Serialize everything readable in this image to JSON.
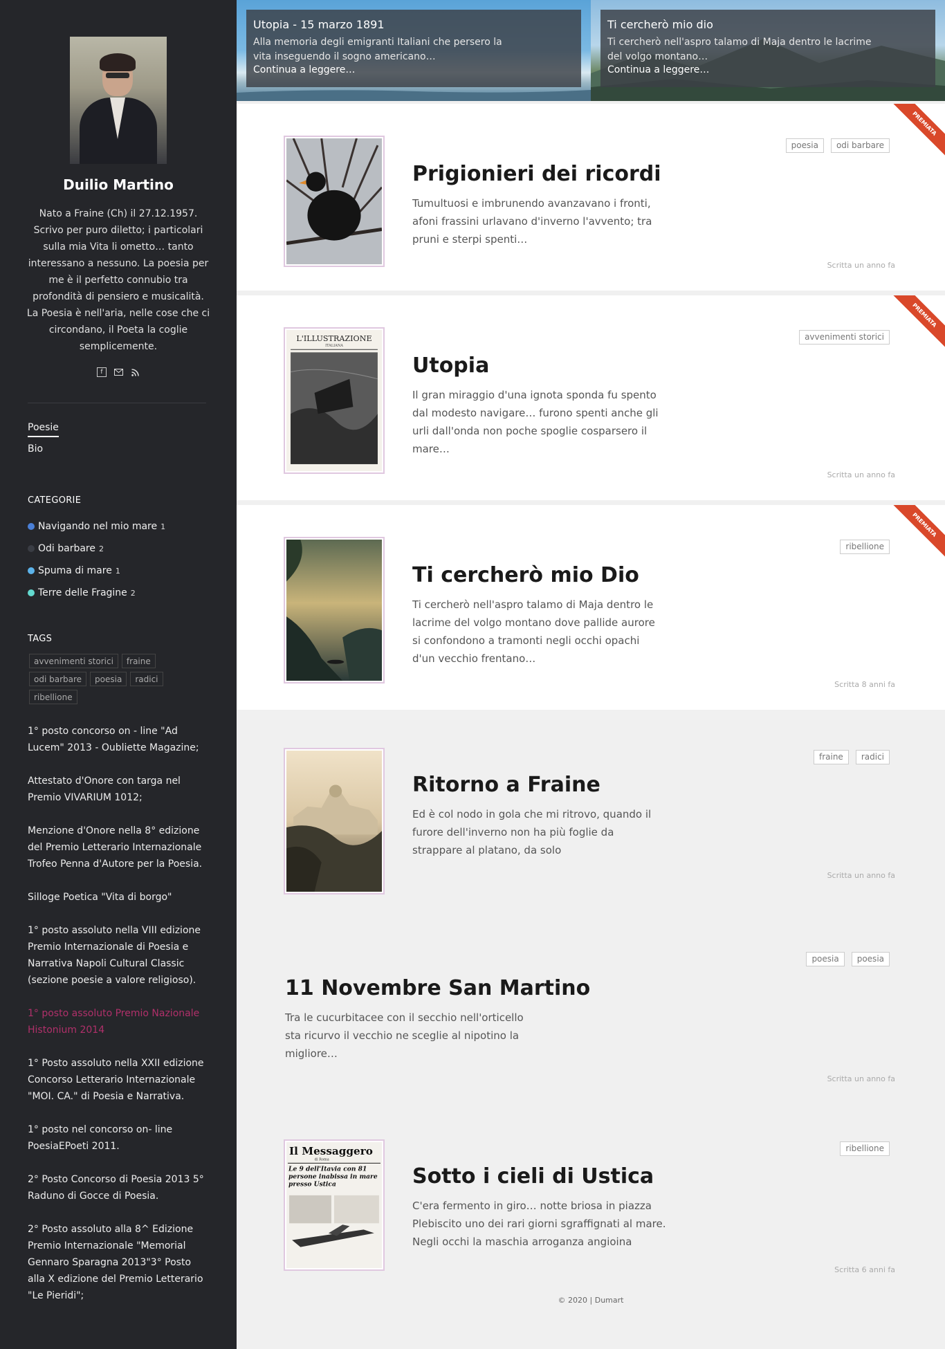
{
  "author": {
    "name": "Duilio Martino",
    "bio": "Nato a Fraine (Ch) il 27.12.1957. Scrivo per puro diletto; i particolari sulla mia Vita li ometto… tanto interessano a nessuno. La poesia per me è il perfetto connubio tra profondità di pensiero e musicalità. La Poesia è nell'aria, nelle cose che ci circondano, il Poeta la coglie semplicemente.",
    "social_icons": [
      "facebook-icon",
      "mail-icon",
      "rss-icon"
    ]
  },
  "nav": [
    {
      "label": "Poesie",
      "active": true
    },
    {
      "label": "Bio",
      "active": false
    }
  ],
  "categories": {
    "heading": "CATEGORIE",
    "items": [
      {
        "label": "Navigando nel mio mare",
        "count": "1",
        "color": "#4a7fd6"
      },
      {
        "label": "Odi barbare",
        "count": "2",
        "color": "#3a3d44"
      },
      {
        "label": "Spuma di mare",
        "count": "1",
        "color": "#5cb3ea"
      },
      {
        "label": "Terre delle Fragine",
        "count": "2",
        "color": "#63d9cf"
      }
    ]
  },
  "tags": {
    "heading": "TAGS",
    "items": [
      "avvenimenti storici",
      "fraine",
      "odi barbare",
      "poesia",
      "radici",
      "ribellione"
    ]
  },
  "awards": [
    {
      "text": "1° posto concorso on - line \"Ad Lucem\" 2013 - Oubliette Magazine;",
      "highlight": false
    },
    {
      "text": "Attestato d'Onore con targa nel Premio VIVARIUM 1012;",
      "highlight": false
    },
    {
      "text": "Menzione d'Onore nella 8° edizione del Premio Letterario Internazionale Trofeo Penna d'Autore per la Poesia.",
      "highlight": false
    },
    {
      "text": "Silloge Poetica \"Vita di borgo\"",
      "highlight": false
    },
    {
      "text": "1° posto assoluto nella VIII edizione Premio Internazionale di Poesia e Narrativa Napoli Cultural Classic (sezione poesie a valore religioso).",
      "highlight": false
    },
    {
      "text": "1° posto assoluto Premio Nazionale Histonium 2014",
      "highlight": true
    },
    {
      "text": "1° Posto assoluto nella XXII edizione Concorso Letterario Internazionale \"MOI. CA.\" di Poesia e Narrativa.",
      "highlight": false
    },
    {
      "text": "1° posto nel concorso on- line PoesiaEPoeti 2011.",
      "highlight": false
    },
    {
      "text": "2° Posto Concorso di Poesia 2013 5° Raduno di Gocce di Poesia.",
      "highlight": false
    },
    {
      "text": "2° Posto assoluto alla 8^ Edizione Premio Internazionale \"Memorial Gennaro Sparagna 2013\"3° Posto alla X edizione del Premio Letterario \"Le Pieridi\";",
      "highlight": false
    }
  ],
  "hero": [
    {
      "title": "Utopia - 15 marzo 1891",
      "excerpt": "Alla memoria degli emigranti Italiani che persero la vita inseguendo il sogno americano…",
      "link": "Continua a leggere…"
    },
    {
      "title": "Ti cercherò mio dio",
      "excerpt": "Ti cercherò nell'aspro talamo di Maja dentro le lacrime del volgo montano…",
      "link": "Continua a leggere…"
    }
  ],
  "ribbon_label": "PREMIATA",
  "posts": [
    {
      "title": "Prigionieri dei ricordi",
      "excerpt": "Tumultuosi e imbrunendo avanzavano i fronti, afoni frassini urlavano d'inverno l'avvento; tra pruni e sterpi spenti…",
      "tags": [
        "poesia",
        "odi barbare"
      ],
      "date": "Scritta un anno fa",
      "awarded": true
    },
    {
      "title": "Utopia",
      "excerpt": "Il gran miraggio d'una ignota sponda fu spento dal modesto navigare… furono spenti anche gli urli dall'onda non poche spoglie cosparsero il mare…",
      "tags": [
        "avvenimenti storici"
      ],
      "date": "Scritta un anno fa",
      "awarded": true
    },
    {
      "title": "Ti cercherò mio Dio",
      "excerpt": "Ti cercherò nell'aspro talamo di Maja dentro le lacrime del volgo montano dove pallide aurore si confondono a tramonti negli occhi opachi d'un vecchio frentano…",
      "tags": [
        "ribellione"
      ],
      "date": "Scritta 8 anni fa",
      "awarded": true
    },
    {
      "title": "Ritorno a Fraine",
      "excerpt": "Ed è col nodo in gola che mi ritrovo, quando il furore dell'inverno non ha più foglie da strappare al platano, da solo",
      "tags": [
        "fraine",
        "radici"
      ],
      "date": "Scritta un anno fa",
      "awarded": false
    },
    {
      "title": "11 Novembre San Martino",
      "excerpt": "Tra le cucurbitacee con il secchio nell'orticello sta ricurvo il vecchio ne sceglie al nipotino la migliore…",
      "tags": [
        "poesia",
        "poesia"
      ],
      "date": "Scritta un anno fa",
      "awarded": false
    },
    {
      "title": "Sotto i cieli di Ustica",
      "excerpt": "C'era fermento in giro… notte briosa in piazza Plebiscito uno dei rari giorni sgraffignati al mare. Negli occhi la maschia arroganza angioina",
      "tags": [
        "ribellione"
      ],
      "date": "Scritta 6 anni fa",
      "awarded": false
    }
  ],
  "thumbnails": {
    "utopia_masthead": "L'ILLUSTRAZIONE",
    "utopia_sub": "ITALIANA",
    "ustica_masthead": "Il Messaggero",
    "ustica_sub": "di Roma",
    "ustica_headline": "Le 9 dell'Itavia con 81 persone inabissa in mare presso Ustica"
  },
  "footer": "© 2020 | Dumart"
}
